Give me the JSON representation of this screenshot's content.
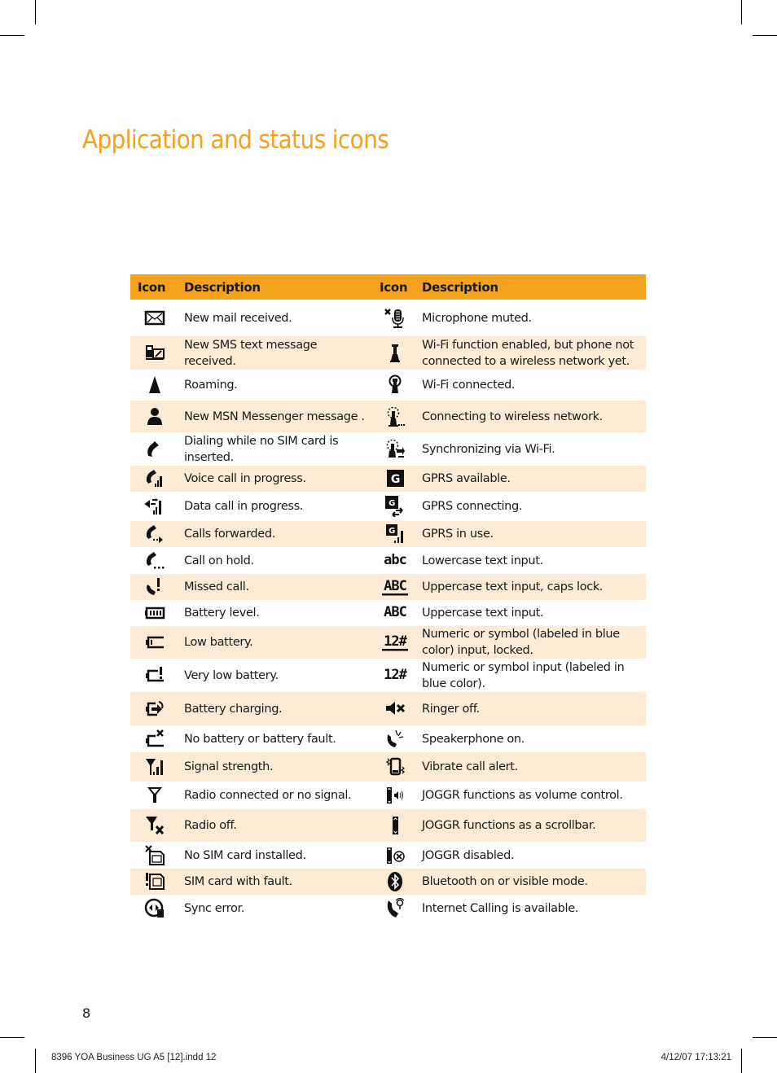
{
  "page": {
    "title": "Application and status icons",
    "page_number": "8",
    "slug_left": "8396 YOA Business UG A5 [12].indd   12",
    "slug_right": "4/12/07   17:13:21",
    "accent_color": "#f4a11d",
    "row_alt_color": "#fdebd6"
  },
  "table": {
    "headers": [
      "Icon",
      "Description",
      "Icon",
      "Description"
    ],
    "rows": [
      {
        "left_icon": "mail-icon",
        "left": "New mail received.",
        "right_icon": "microphone-muted-icon",
        "right": "Microphone muted."
      },
      {
        "left_icon": "sms-icon",
        "left": "New SMS text message received.",
        "right_icon": "wifi-enabled-icon",
        "right": "Wi-Fi function enabled, but phone not connected to a wireless network yet."
      },
      {
        "left_icon": "roaming-icon",
        "left": "Roaming.",
        "right_icon": "wifi-connected-icon",
        "right": "Wi-Fi connected."
      },
      {
        "left_icon": "msn-messenger-icon",
        "left": "New MSN Messenger message .",
        "right_icon": "wifi-connecting-icon",
        "right": "Connecting to wireless network."
      },
      {
        "left_icon": "dialing-no-sim-icon",
        "left": "Dialing while no SIM card is inserted.",
        "right_icon": "wifi-sync-icon",
        "right": "Synchronizing via Wi-Fi."
      },
      {
        "left_icon": "voice-call-icon",
        "left": "Voice call in progress.",
        "right_icon": "gprs-available-icon",
        "right": "GPRS available."
      },
      {
        "left_icon": "data-call-icon",
        "left": "Data call in progress.",
        "right_icon": "gprs-connecting-icon",
        "right": "GPRS connecting."
      },
      {
        "left_icon": "calls-forwarded-icon",
        "left": "Calls forwarded.",
        "right_icon": "gprs-in-use-icon",
        "right": "GPRS in use."
      },
      {
        "left_icon": "call-on-hold-icon",
        "left": "Call on hold.",
        "right_icon": "lowercase-input-icon",
        "right": "Lowercase text input.",
        "right_glyph": "abc"
      },
      {
        "left_icon": "missed-call-icon",
        "left": "Missed call.",
        "right_icon": "caps-lock-input-icon",
        "right": "Uppercase text input, caps lock.",
        "right_glyph": "ABC"
      },
      {
        "left_icon": "battery-level-icon",
        "left": "Battery level.",
        "right_icon": "uppercase-input-icon",
        "right": "Uppercase text input.",
        "right_glyph": "ABC"
      },
      {
        "left_icon": "low-battery-icon",
        "left": "Low battery.",
        "right_icon": "numeric-locked-icon",
        "right": "Numeric or symbol (labeled in blue color) input, locked.",
        "right_glyph": "12#"
      },
      {
        "left_icon": "very-low-battery-icon",
        "left": "Very low battery.",
        "right_icon": "numeric-input-icon",
        "right": "Numeric or symbol input (labeled in blue color).",
        "right_glyph": "12#"
      },
      {
        "left_icon": "battery-charging-icon",
        "left": "Battery charging.",
        "right_icon": "ringer-off-icon",
        "right": "Ringer off."
      },
      {
        "left_icon": "battery-fault-icon",
        "left": "No battery or battery fault.",
        "right_icon": "speakerphone-icon",
        "right": "Speakerphone on."
      },
      {
        "left_icon": "signal-strength-icon",
        "left": "Signal strength.",
        "right_icon": "vibrate-icon",
        "right": "Vibrate call alert."
      },
      {
        "left_icon": "radio-connected-icon",
        "left": "Radio connected or no signal.",
        "right_icon": "joggr-volume-icon",
        "right": "JOGGR functions as volume control."
      },
      {
        "left_icon": "radio-off-icon",
        "left": "Radio off.",
        "right_icon": "joggr-scrollbar-icon",
        "right": "JOGGR functions as a scrollbar."
      },
      {
        "left_icon": "no-sim-icon",
        "left": "No SIM card installed.",
        "right_icon": "joggr-disabled-icon",
        "right": "JOGGR disabled."
      },
      {
        "left_icon": "sim-fault-icon",
        "left": "SIM card with fault.",
        "right_icon": "bluetooth-icon",
        "right": "Bluetooth on or visible mode."
      },
      {
        "left_icon": "sync-error-icon",
        "left": "Sync error.",
        "right_icon": "internet-calling-icon",
        "right": "Internet Calling is available."
      }
    ]
  }
}
